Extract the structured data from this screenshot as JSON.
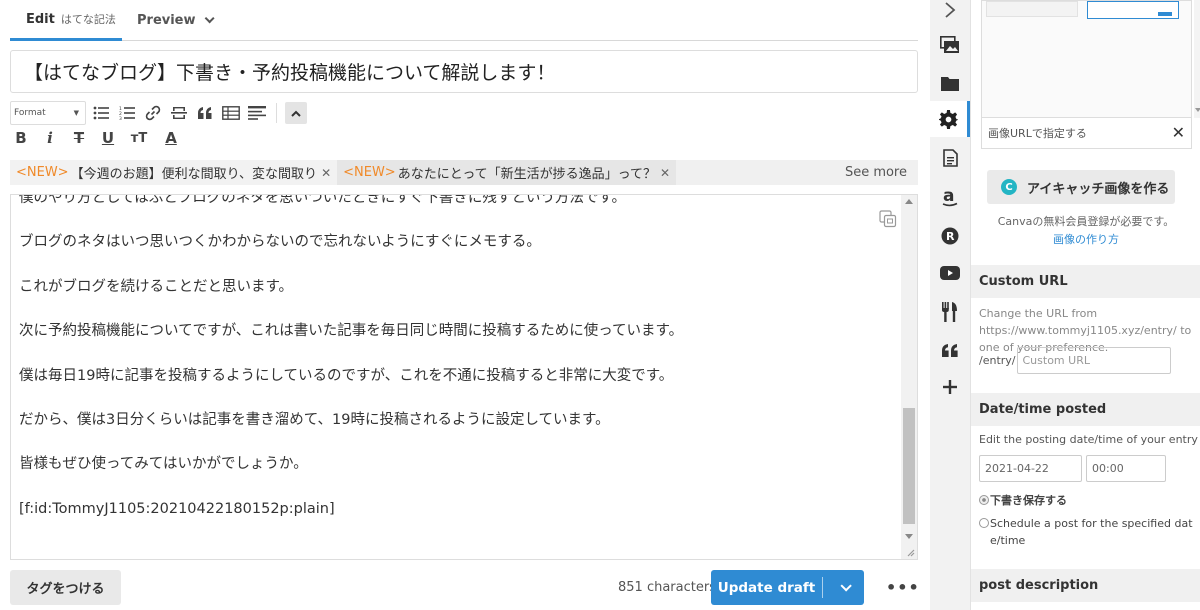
{
  "tabs": {
    "edit_label": "Edit",
    "edit_sub": "はてな記法",
    "preview_label": "Preview"
  },
  "title": "【はてなブログ】下書き・予約投稿機能について解説します！",
  "toolbar": {
    "format_label": "Format",
    "bold": "B",
    "italic": "i",
    "strike": "T",
    "underline": "U",
    "size": "тT",
    "color": "A"
  },
  "topics": {
    "items": [
      {
        "new_tag": "<NEW>",
        "text": "【今週のお題】便利な間取り、変な間取り"
      },
      {
        "new_tag": "<NEW>",
        "text": "あなたにとって「新生活が捗る逸品」って？"
      }
    ],
    "see_more": "See more"
  },
  "editor": {
    "lines": [
      "僕のやり方としてはふとブログのネタを思いついたときにすぐ下書きに残すという方法です。",
      "ブログのネタはいつ思いつくかわからないので忘れないようにすぐにメモする。",
      "これがブログを続けることだと思います。",
      "次に予約投稿機能についてですが、これは書いた記事を毎日同じ時間に投稿するために使っています。",
      "僕は毎日19時に記事を投稿するようにしているのですが、これを不通に投稿すると非常に大変です。",
      "だから、僕は3日分くらいは記事を書き溜めて、19時に投稿されるように設定しています。",
      "皆様もぜひ使ってみてはいかがでしょうか。",
      "[f:id:TommyJ1105:20210422180152p:plain]"
    ]
  },
  "bottom": {
    "tag_button": "タグをつける",
    "char_count": "851 characters",
    "update_button": "Update draft",
    "more": "•••"
  },
  "rail": {
    "icons": [
      "chevron-right-icon",
      "photos-icon",
      "folder-icon",
      "gear-icon",
      "document-icon",
      "amazon-icon",
      "rakuten-icon",
      "youtube-icon",
      "restaurant-icon",
      "quote-icon",
      "plus-icon"
    ],
    "active": "gear-icon"
  },
  "panel": {
    "url_spec_label": "画像URLで指定する",
    "eyecatch_button": "アイキャッチ画像を作る",
    "canva_letter": "C",
    "canva_note": "Canvaの無料会員登録が必要です。",
    "canva_link": "画像の作り方",
    "custom_url": {
      "heading": "Custom URL",
      "desc": "Change the URL from https://www.tommyj1105.xyz/entry/ to one of your preference.",
      "prefix": "/entry/",
      "placeholder": "Custom URL"
    },
    "datetime": {
      "heading": "Date/time posted",
      "desc": "Edit the posting date/time of your entry",
      "date": "2021-04-22",
      "time": "00:00",
      "option_draft": "下書き保存する",
      "option_schedule": "Schedule a post for the specified date/time"
    },
    "post_description": {
      "heading": "post description"
    }
  },
  "colors": {
    "accent": "#2f8bd3",
    "new_tag": "#f08a2a",
    "canva": "#23b5c4"
  }
}
